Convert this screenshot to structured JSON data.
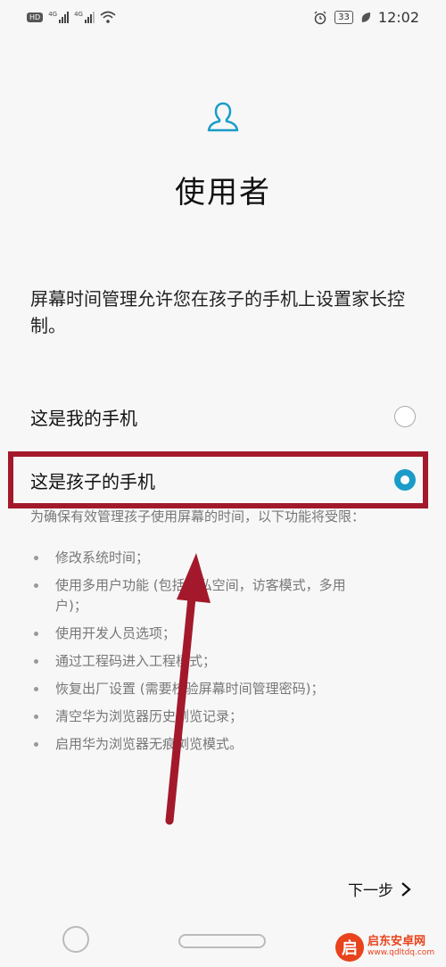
{
  "status_bar": {
    "left_badge": "HD",
    "sim1_label": "4G",
    "sim2_label": "4G",
    "battery_level": "33",
    "time": "12:02"
  },
  "header": {
    "icon": "user-icon",
    "title": "使用者"
  },
  "description": "屏幕时间管理允许您在孩子的手机上设置家长控制。",
  "options": [
    {
      "label": "这是我的手机",
      "selected": false
    },
    {
      "label": "这是孩子的手机",
      "selected": true
    }
  ],
  "note": "为确保有效管理孩子使用屏幕的时间，以下功能将受限：",
  "restrictions": [
    "修改系统时间；",
    "使用多用户功能 (包括隐私空间，访客模式，多用户)；",
    "使用开发人员选项；",
    "通过工程码进入工程模式；",
    "恢复出厂设置 (需要校验屏幕时间管理密码)；",
    "清空华为浏览器历史浏览记录；",
    "启用华为浏览器无痕浏览模式。"
  ],
  "footer": {
    "next_label": "下一步"
  },
  "watermark": {
    "name": "启东安卓网",
    "url": "www.qdltdq.com"
  },
  "colors": {
    "accent": "#1a9cc9",
    "annotation": "#a3192b"
  }
}
